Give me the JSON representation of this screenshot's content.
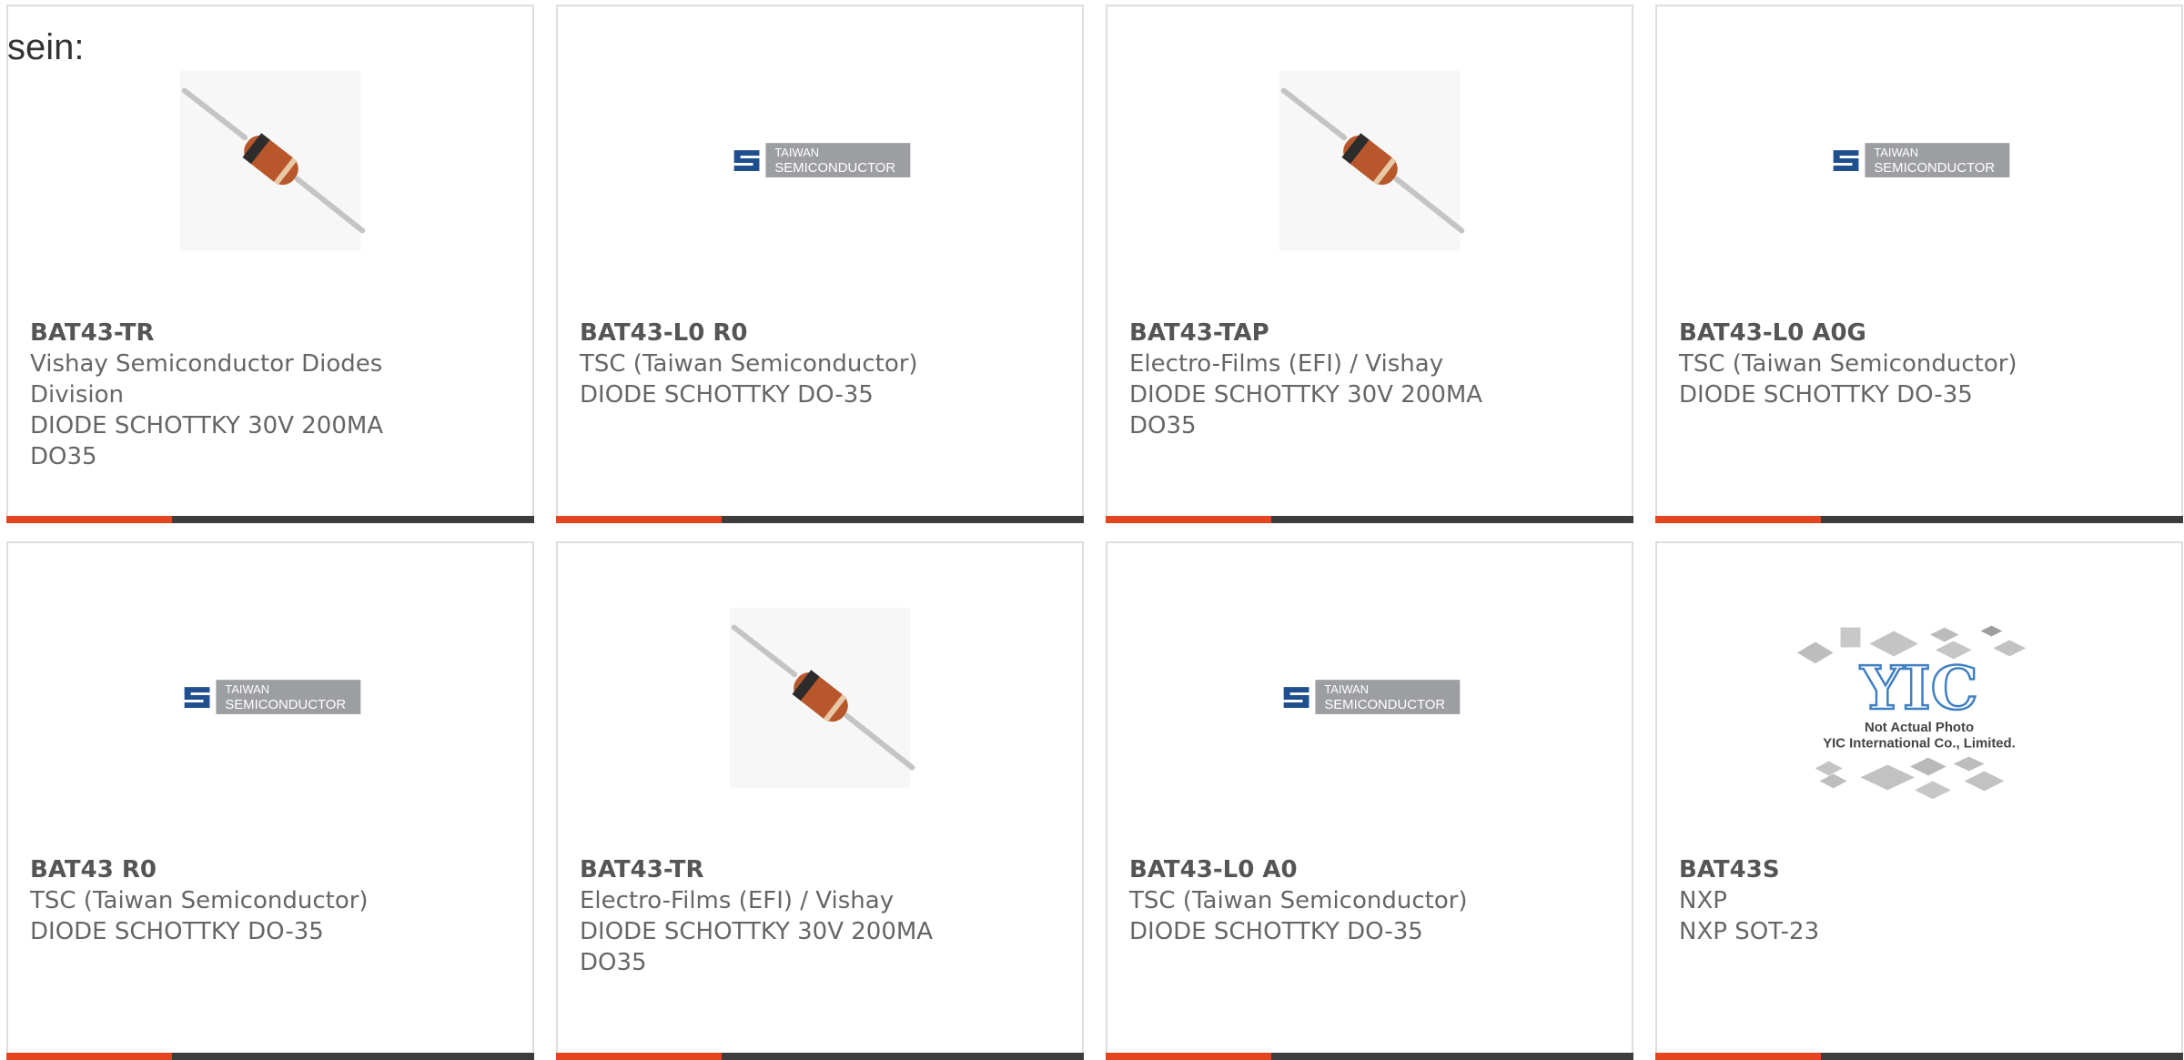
{
  "lead_text": "sein:",
  "products": [
    {
      "part": "BAT43-TR",
      "manufacturer": "Vishay Semiconductor Diodes\nDivision",
      "description": "DIODE SCHOTTKY 30V 200MA\nDO35",
      "image": "diode-photo"
    },
    {
      "part": "BAT43-L0 R0",
      "manufacturer": "TSC (Taiwan Semiconductor)",
      "description": "DIODE SCHOTTKY DO-35",
      "image": "taiwan-semiconductor-logo"
    },
    {
      "part": "BAT43-TAP",
      "manufacturer": "Electro-Films (EFI) / Vishay",
      "description": "DIODE SCHOTTKY 30V 200MA\nDO35",
      "image": "diode-photo"
    },
    {
      "part": "BAT43-L0 A0G",
      "manufacturer": "TSC (Taiwan Semiconductor)",
      "description": "DIODE SCHOTTKY DO-35",
      "image": "taiwan-semiconductor-logo"
    },
    {
      "part": "BAT43 R0",
      "manufacturer": "TSC (Taiwan Semiconductor)",
      "description": "DIODE SCHOTTKY DO-35",
      "image": "taiwan-semiconductor-logo"
    },
    {
      "part": "BAT43-TR",
      "manufacturer": "Electro-Films (EFI) / Vishay",
      "description": "DIODE SCHOTTKY 30V 200MA\nDO35",
      "image": "diode-photo"
    },
    {
      "part": "BAT43-L0 A0",
      "manufacturer": "TSC (Taiwan Semiconductor)",
      "description": "DIODE SCHOTTKY DO-35",
      "image": "taiwan-semiconductor-logo"
    },
    {
      "part": "BAT43S",
      "manufacturer": "NXP",
      "description": "NXP SOT-23",
      "image": "yic-placeholder"
    }
  ],
  "logo_text": {
    "line1": "TAIWAN",
    "line2": "SEMICONDUCTOR"
  },
  "placeholder_text": {
    "line1": "Not Actual Photo",
    "line2": "YIC International Co., Limited."
  },
  "colors": {
    "accent": "#e3461e",
    "bar": "#3d3d3d",
    "border": "#dedede",
    "text": "#666666"
  }
}
